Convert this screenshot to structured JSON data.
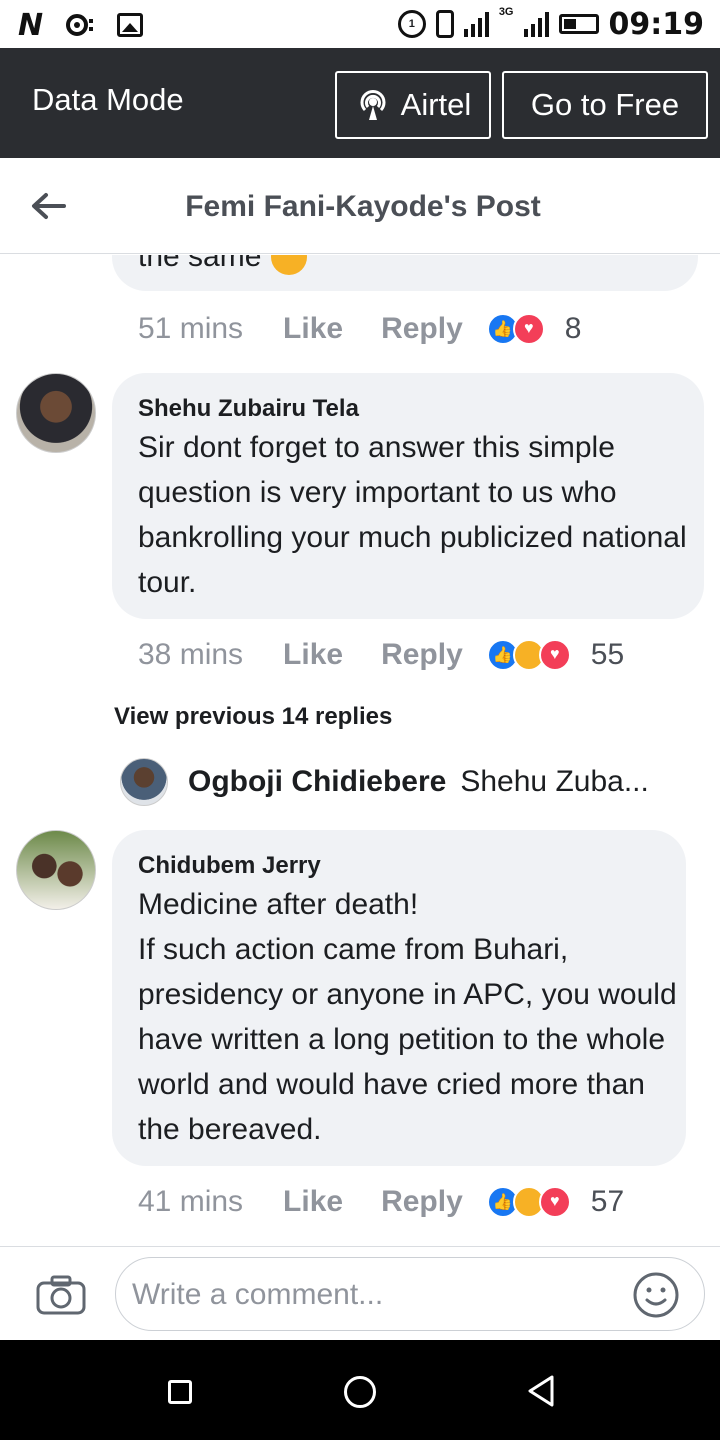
{
  "status_bar": {
    "carrier_logo": "N",
    "time": "09:19",
    "network": "3G",
    "icons": [
      "notification-icon",
      "image-icon",
      "data-saver-icon",
      "vibrate-icon",
      "signal-icon",
      "battery-icon"
    ]
  },
  "data_bar": {
    "title": "Data Mode",
    "airtel_label": "Airtel",
    "free_label": "Go to Free"
  },
  "header": {
    "title": "Femi Fani-Kayode's Post"
  },
  "comments": [
    {
      "partial_text": "the same",
      "time": "51 mins",
      "like_label": "Like",
      "reply_label": "Reply",
      "reactions": [
        "like",
        "love"
      ],
      "reaction_count": "8"
    },
    {
      "author": "Shehu Zubairu Tela",
      "text": "Sir dont forget to answer this simple question is very important to us who bankrolling your much publicized national tour.",
      "time": "38 mins",
      "like_label": "Like",
      "reply_label": "Reply",
      "reactions": [
        "like",
        "haha",
        "love"
      ],
      "reaction_count": "55"
    },
    {
      "author": "Chidubem Jerry",
      "text": "Medicine after death!\nIf such action came from Buhari, presidency or anyone in APC, you would have written a long petition to the whole world and would have cried more than the bereaved.",
      "time": "41 mins",
      "like_label": "Like",
      "reply_label": "Reply",
      "reactions": [
        "like",
        "haha",
        "love"
      ],
      "reaction_count": "57"
    }
  ],
  "replies": {
    "view_previous_label": "View previous 14 replies",
    "latest_author": "Ogboji Chidiebere",
    "latest_snippet": "Shehu Zuba..."
  },
  "composer": {
    "placeholder": "Write a comment..."
  },
  "colors": {
    "data_bar_bg": "#2b2d31",
    "bubble_bg": "#f0f2f5",
    "meta_text": "#90949c",
    "like_blue": "#1877f2",
    "love_red": "#f33e58",
    "haha_yellow": "#f7b125"
  }
}
